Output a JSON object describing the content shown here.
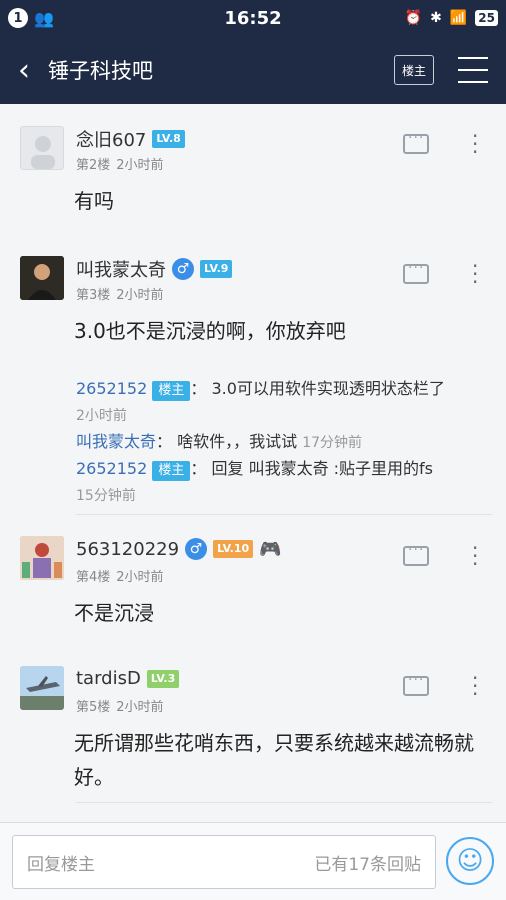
{
  "status": {
    "left_badge": "1",
    "time": "16:52",
    "battery": "25"
  },
  "nav": {
    "title": "锤子科技吧",
    "owner_btn": "楼主"
  },
  "posts": [
    {
      "user": "念旧607",
      "level": "LV.8",
      "floor": "第2楼",
      "time": "2小时前",
      "text": "有吗"
    },
    {
      "user": "叫我蒙太奇",
      "level": "LV.9",
      "gender": "♂",
      "floor": "第3楼",
      "time": "2小时前",
      "text": "3.0也不是沉浸的啊，你放弃吧",
      "replies": [
        {
          "user": "2652152",
          "tag": "楼主",
          "sep": "：",
          "text": "3.0可以用软件实现透明状态栏了",
          "time": "2小时前"
        },
        {
          "user": "叫我蒙太奇",
          "sep": "：",
          "text": "啥软件，，我试试",
          "time": "17分钟前"
        },
        {
          "user": "2652152",
          "tag": "楼主",
          "sep": "：",
          "text": "回复 叫我蒙太奇 :贴子里用的fs",
          "time": "15分钟前"
        }
      ]
    },
    {
      "user": "563120229",
      "level": "LV.10",
      "gender": "♂",
      "floor": "第4楼",
      "time": "2小时前",
      "text": "不是沉浸"
    },
    {
      "user": "tardisD",
      "level": "LV.3",
      "floor": "第5楼",
      "time": "2小时前",
      "text": "无所谓那些花哨东西，只要系统越来越流畅就好。"
    }
  ],
  "bottom": {
    "placeholder": "回复楼主",
    "count": "已有17条回贴"
  }
}
